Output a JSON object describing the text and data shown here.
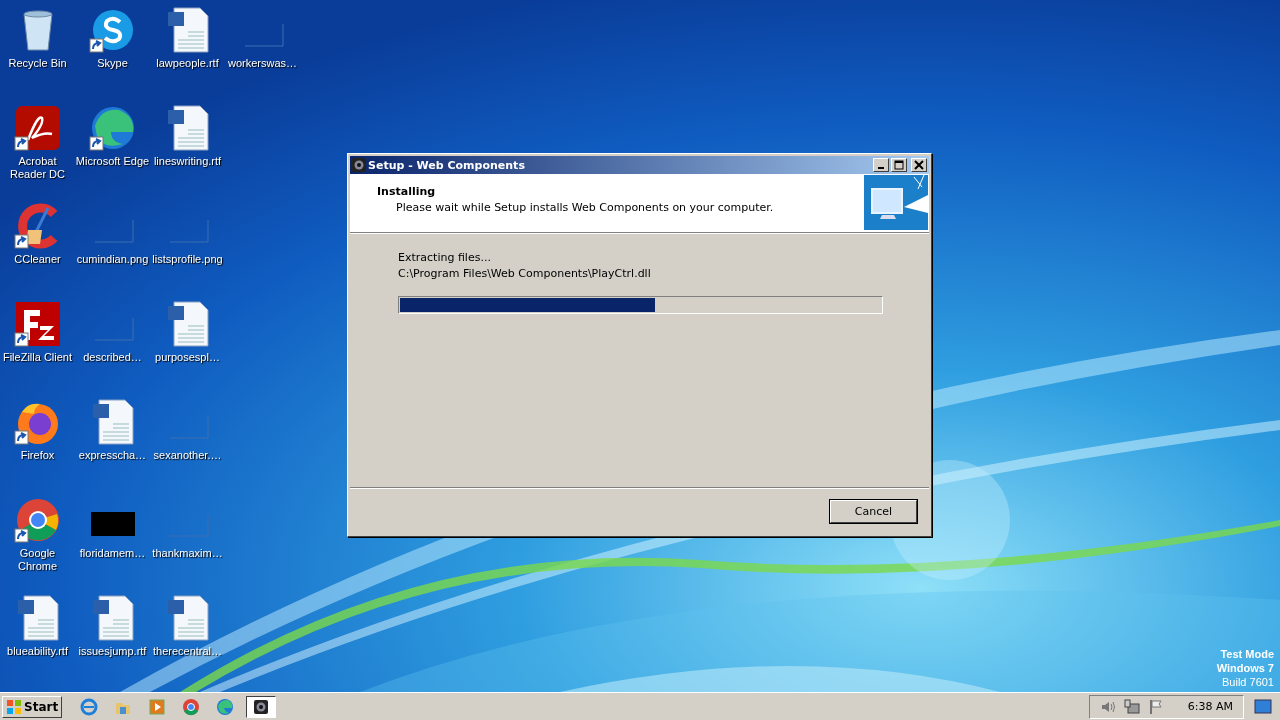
{
  "desktop": {
    "icons": [
      {
        "label": "Recycle Bin",
        "kind": "recycle",
        "shortcut": false
      },
      {
        "label": "Acrobat Reader DC",
        "kind": "acrobat",
        "shortcut": true
      },
      {
        "label": "CCleaner",
        "kind": "ccleaner",
        "shortcut": true
      },
      {
        "label": "FileZilla Client",
        "kind": "filezilla",
        "shortcut": true
      },
      {
        "label": "Firefox",
        "kind": "firefox",
        "shortcut": true
      },
      {
        "label": "Google Chrome",
        "kind": "chrome",
        "shortcut": true
      },
      {
        "label": "blueability.rtf",
        "kind": "word",
        "shortcut": false
      },
      {
        "label": "Skype",
        "kind": "skype",
        "shortcut": true
      },
      {
        "label": "Microsoft Edge",
        "kind": "edge",
        "shortcut": true
      },
      {
        "label": "cumindian.png",
        "kind": "blank",
        "shortcut": false
      },
      {
        "label": "described…",
        "kind": "blank",
        "shortcut": false
      },
      {
        "label": "expresscha…",
        "kind": "word",
        "shortcut": false
      },
      {
        "label": "floridamem…",
        "kind": "dark",
        "shortcut": false
      },
      {
        "label": "issuesjump.rtf",
        "kind": "word",
        "shortcut": false
      },
      {
        "label": "lawpeople.rtf",
        "kind": "word",
        "shortcut": false
      },
      {
        "label": "lineswriting.rtf",
        "kind": "word",
        "shortcut": false
      },
      {
        "label": "listsprofile.png",
        "kind": "blank",
        "shortcut": false
      },
      {
        "label": "purposespl…",
        "kind": "word",
        "shortcut": false
      },
      {
        "label": "sexanother.…",
        "kind": "blank",
        "shortcut": false
      },
      {
        "label": "thankmaxim…",
        "kind": "blank",
        "shortcut": false
      },
      {
        "label": "therecentral…",
        "kind": "word",
        "shortcut": false
      },
      {
        "label": "workerswas…",
        "kind": "blank",
        "shortcut": false
      }
    ],
    "os_notice": [
      "Test Mode",
      "Windows 7",
      "Build 7601"
    ]
  },
  "window": {
    "title": "Setup - Web Components",
    "heading": "Installing",
    "subheading": "Please wait while Setup installs Web Components on your computer.",
    "status": "Extracting files...",
    "path": "C:\\Program Files\\Web Components\\PlayCtrl.dll",
    "progress": {
      "level": 0.53
    },
    "buttons": [
      "Cancel"
    ]
  },
  "taskbar": {
    "start": "Start",
    "quick_launch": [
      {
        "kind": "ie"
      },
      {
        "kind": "folder"
      },
      {
        "kind": "media"
      },
      {
        "kind": "chrome"
      },
      {
        "kind": "edge"
      }
    ],
    "tasks": [
      {
        "kind": "setup",
        "selected": true
      }
    ],
    "tray": {
      "time": "6:38 AM"
    }
  }
}
